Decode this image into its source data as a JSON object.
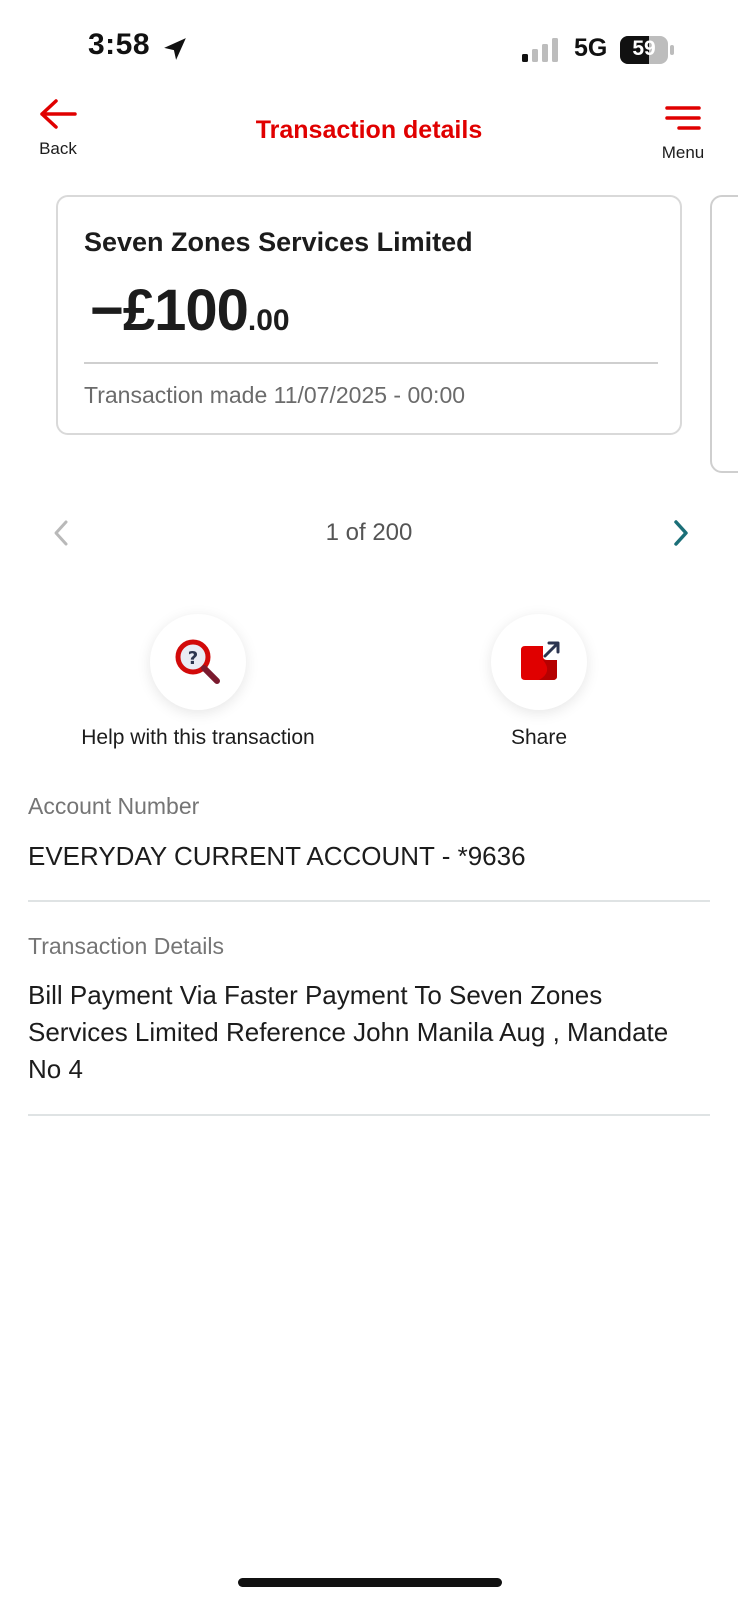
{
  "status_bar": {
    "time": "3:58",
    "network": "5G",
    "battery": "59"
  },
  "header": {
    "back_label": "Back",
    "title": "Transaction details",
    "menu_label": "Menu"
  },
  "transaction": {
    "merchant": "Seven Zones Services Limited",
    "amount_main": "−£100",
    "amount_pence": ".00",
    "made_label": "Transaction made 11/07/2025 - 00:00"
  },
  "pager": {
    "text": "1 of 200"
  },
  "actions": {
    "help_label": "Help with this transaction",
    "share_label": "Share"
  },
  "details": {
    "account_label": "Account Number",
    "account_value": "EVERYDAY CURRENT ACCOUNT - *9636",
    "details_label": "Transaction Details",
    "details_value": "Bill Payment Via Faster Payment To Seven Zones Services Limited Reference John Manila Aug , Mandate No 4"
  },
  "colors": {
    "brand_red": "#e00000",
    "teal": "#1b6f78",
    "disabled": "#b9b9b9"
  },
  "icons": [
    "location-arrow-icon",
    "signal-icon",
    "battery-icon",
    "back-arrow-icon",
    "menu-icon",
    "chevron-left-icon",
    "chevron-right-icon",
    "help-magnifier-icon",
    "share-icon"
  ]
}
